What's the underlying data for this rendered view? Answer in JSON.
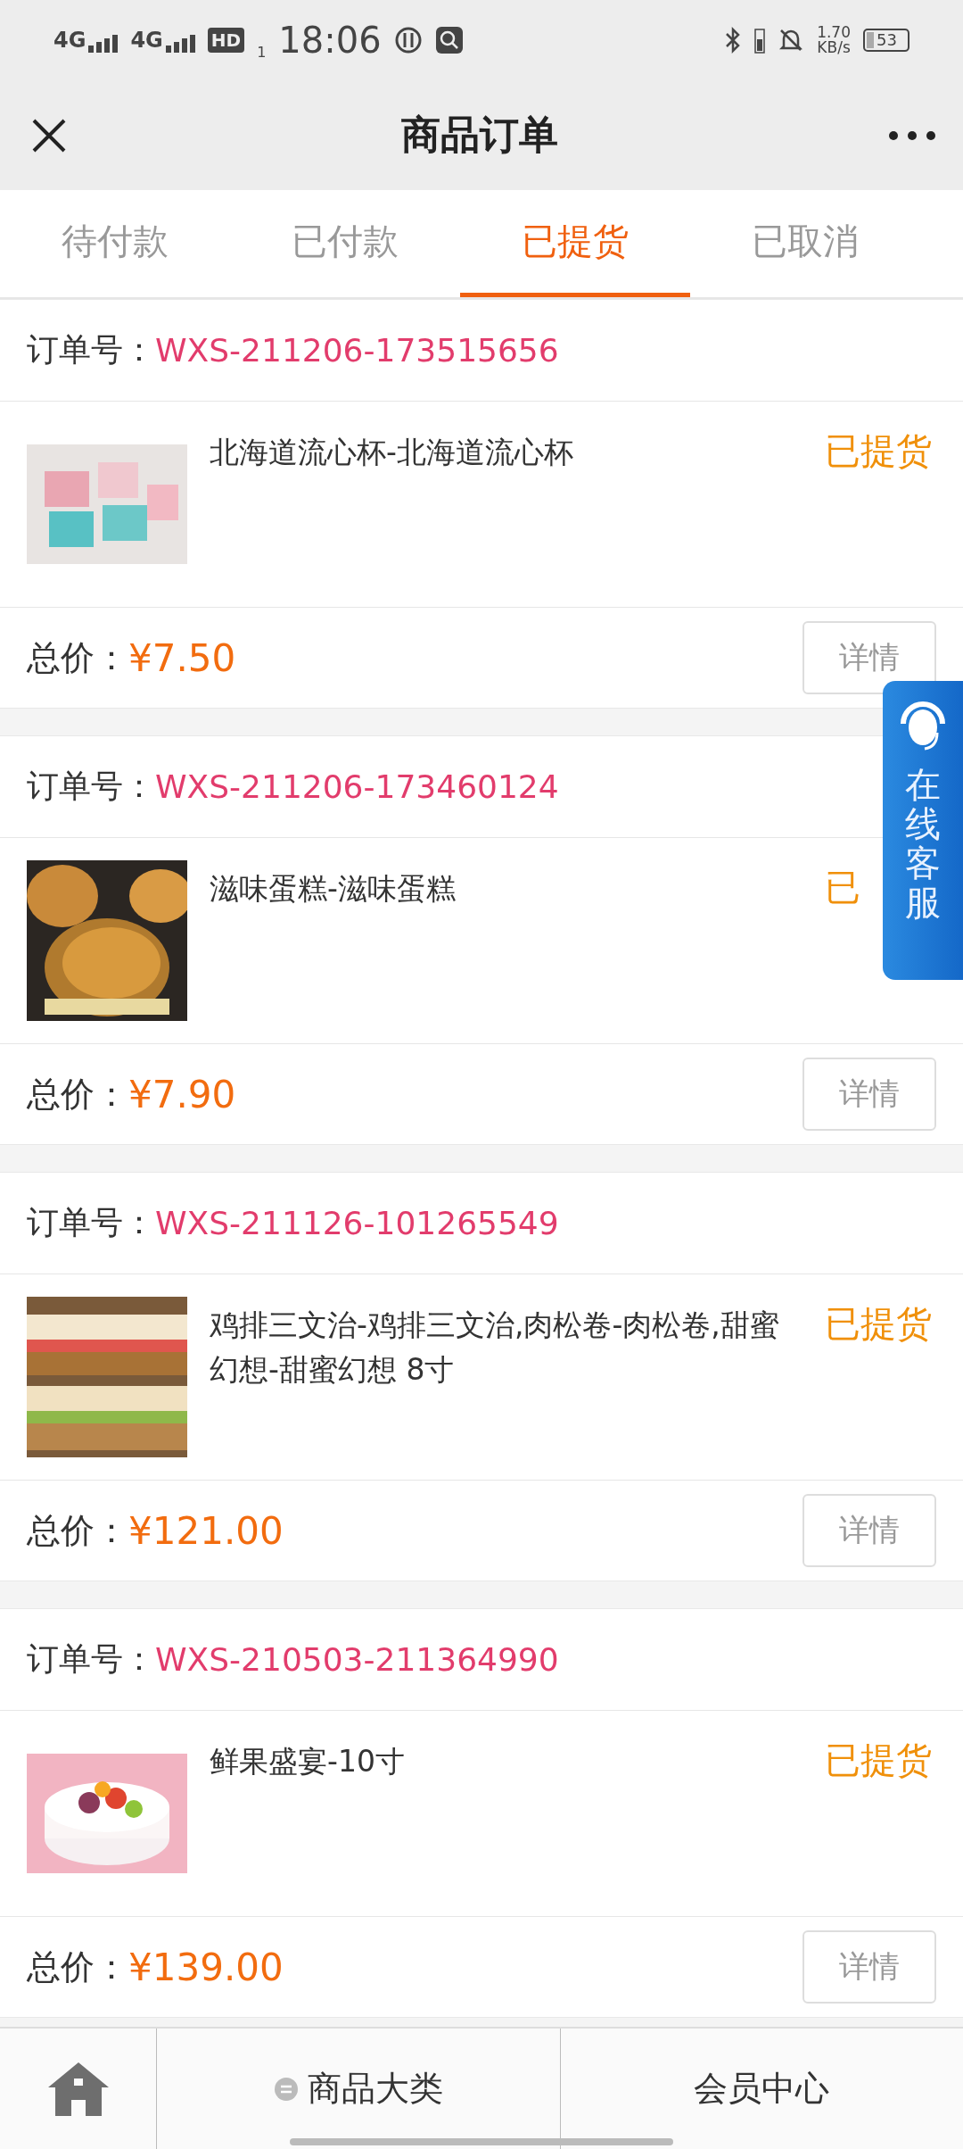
{
  "status_bar": {
    "network_1": "4G",
    "network_2": "4G",
    "hd": "HD",
    "sim": "1",
    "time": "18:06",
    "speed": "1.70",
    "speed_unit": "KB/s",
    "battery": "53"
  },
  "nav": {
    "title": "商品订单"
  },
  "tabs": [
    {
      "label": "待付款",
      "selected": false
    },
    {
      "label": "已付款",
      "selected": false
    },
    {
      "label": "已提货",
      "selected": true
    },
    {
      "label": "已取消",
      "selected": false
    }
  ],
  "orders": [
    {
      "number_label": "订单号：",
      "number": "WXS-211206-173515656",
      "product": "北海道流心杯-北海道流心杯",
      "status": "已提货",
      "total_label": "总价：",
      "total": "¥7.50",
      "detail_button": "详情"
    },
    {
      "number_label": "订单号：",
      "number": "WXS-211206-173460124",
      "product": "滋味蛋糕-滋味蛋糕",
      "status": "已",
      "total_label": "总价：",
      "total": "¥7.90",
      "detail_button": "详情"
    },
    {
      "number_label": "订单号：",
      "number": "WXS-211126-101265549",
      "product": "鸡排三文治-鸡排三文治,肉松卷-肉松卷,甜蜜幻想-甜蜜幻想 8寸",
      "status": "已提货",
      "total_label": "总价：",
      "total": "¥121.00",
      "detail_button": "详情"
    },
    {
      "number_label": "订单号：",
      "number": "WXS-210503-211364990",
      "product": "鲜果盛宴-10寸",
      "status": "已提货",
      "total_label": "总价：",
      "total": "¥139.00",
      "detail_button": "详情"
    }
  ],
  "service_button": {
    "label": "在线客服"
  },
  "bottom_nav": [
    {
      "label": "商品大类"
    },
    {
      "label": "会员中心"
    }
  ]
}
